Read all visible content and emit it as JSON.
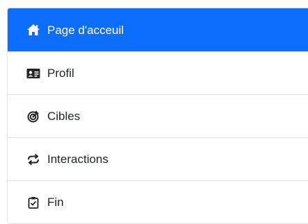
{
  "menu": {
    "items": [
      {
        "label": "Page d'acceuil",
        "icon": "home-icon",
        "active": true
      },
      {
        "label": "Profil",
        "icon": "id-card-icon",
        "active": false
      },
      {
        "label": "Cibles",
        "icon": "target-icon",
        "active": false
      },
      {
        "label": "Interactions",
        "icon": "arrows-rotate-icon",
        "active": false
      },
      {
        "label": "Fin",
        "icon": "clipboard-check-icon",
        "active": false
      }
    ]
  },
  "colors": {
    "active_bg": "#0d6efd",
    "active_text": "#ffffff",
    "text": "#212529",
    "border": "#dee2e6"
  }
}
